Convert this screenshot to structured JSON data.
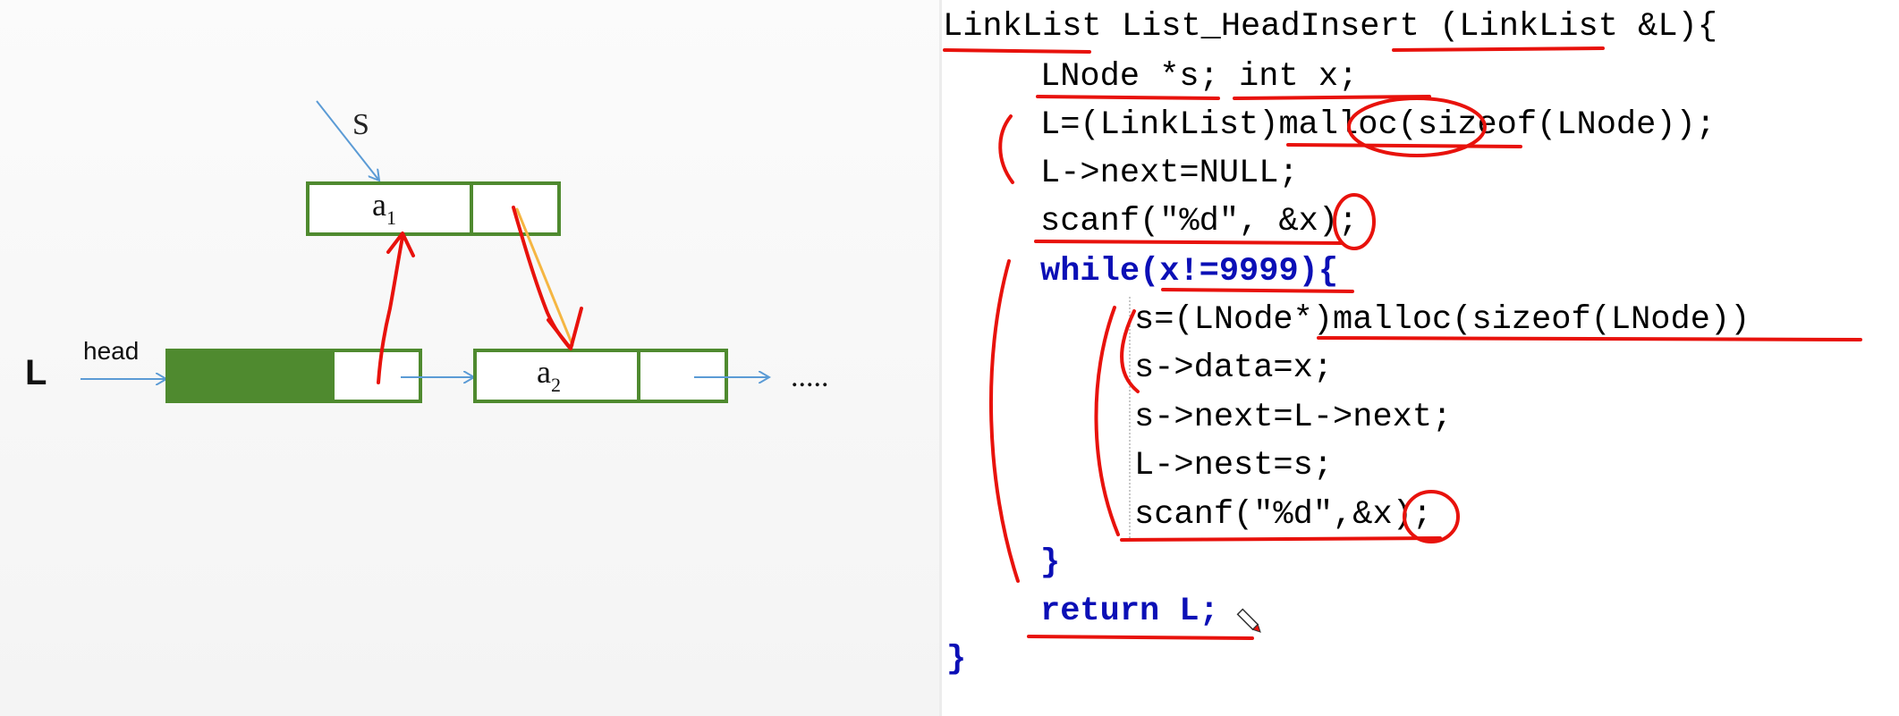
{
  "diagram": {
    "pointer_s_label": "S",
    "node_a1": {
      "base": "a",
      "sub": "1"
    },
    "list_label": "L",
    "head_label": "head",
    "node_a2": {
      "base": "a",
      "sub": "2"
    },
    "ellipsis": "....."
  },
  "code": {
    "lines": [
      "LinkList List_HeadInsert (LinkList &L){",
      "LNode *s; int x;",
      "L=(LinkList)malloc(sizeof(LNode));",
      "L->next=NULL;",
      "scanf(\"%d\", &x);",
      "while(x!=9999){",
      "s=(LNode*)malloc(sizeof(LNode))",
      "s->data=x;",
      "s->next=L->next;",
      "L->nest=s;",
      "scanf(\"%d\",&x);",
      "}",
      "return L;",
      "}"
    ]
  },
  "colors": {
    "node_border": "#4f8a2f",
    "head_fill": "#4f8a2f",
    "arrow_blue": "#5b9bd5",
    "annotation_red": "#e8120c",
    "keyword": "#0b0fb6",
    "type_keyword": "#8a24c9",
    "string": "#8a8a8a",
    "number": "#f39a21"
  }
}
